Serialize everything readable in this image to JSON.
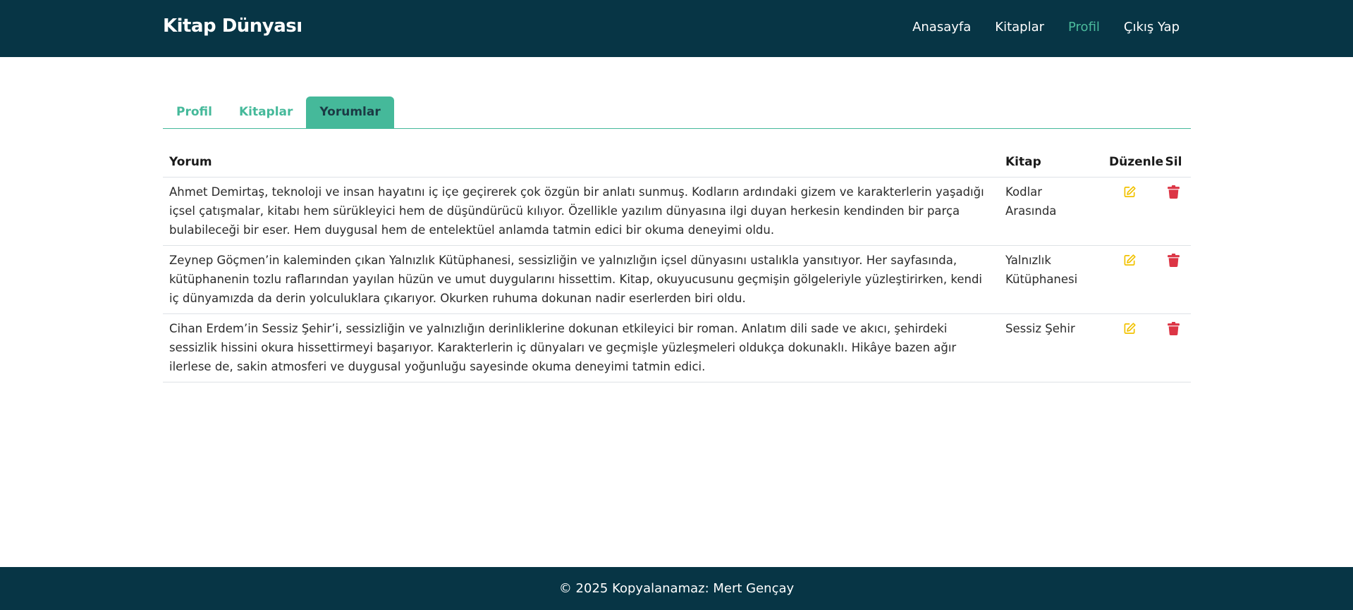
{
  "navbar": {
    "brand": "Kitap Dünyası",
    "links": [
      {
        "label": "Anasayfa"
      },
      {
        "label": "Kitaplar"
      },
      {
        "label": "Profil"
      },
      {
        "label": "Çıkış Yap"
      }
    ],
    "active_link": "Profil",
    "active_color": "#4bbb9c",
    "background": "#073545"
  },
  "tabs": {
    "items": [
      {
        "label": "Profil"
      },
      {
        "label": "Kitaplar"
      },
      {
        "label": "Yorumlar"
      }
    ],
    "active": "Yorumlar",
    "accent": "#45b99a"
  },
  "table": {
    "headers": {
      "comment": "Yorum",
      "book": "Kitap",
      "edit": "Düzenle",
      "delete": "Sil"
    },
    "rows": [
      {
        "comment": "Ahmet Demirtaş, teknoloji ve insan hayatını iç içe geçirerek çok özgün bir anlatı sunmuş. Kodların ardındaki gizem ve karakterlerin yaşadığı içsel çatışmalar, kitabı hem sürükleyici hem de düşündürücü kılıyor. Özellikle yazılım dünyasına ilgi duyan herkesin kendinden bir parça bulabileceği bir eser. Hem duygusal hem de entelektüel anlamda tatmin edici bir okuma deneyimi oldu.",
        "book": "Kodlar Arasında",
        "edit_icon": "edit-icon",
        "delete_icon": "trash-icon"
      },
      {
        "comment": "Zeynep Göçmen’in kaleminden çıkan Yalnızlık Kütüphanesi, sessizliğin ve yalnızlığın içsel dünyasını ustalıkla yansıtıyor. Her sayfasında, kütüphanenin tozlu raflarından yayılan hüzün ve umut duygularını hissettim. Kitap, okuyucusunu geçmişin gölgeleriyle yüzleştirirken, kendi iç dünyamızda da derin yolculuklara çıkarıyor. Okurken ruhuma dokunan nadir eserlerden biri oldu.",
        "book": "Yalnızlık Kütüphanesi",
        "edit_icon": "edit-icon",
        "delete_icon": "trash-icon"
      },
      {
        "comment": "Cihan Erdem’in Sessiz Şehir’i, sessizliğin ve yalnızlığın derinliklerine dokunan etkileyici bir roman. Anlatım dili sade ve akıcı, şehirdeki sessizlik hissini okura hissettirmeyi başarıyor. Karakterlerin iç dünyaları ve geçmişle yüzleşmeleri oldukça dokunaklı. Hikâye bazen ağır ilerlese de, sakin atmosferi ve duygusal yoğunluğu sayesinde okuma deneyimi tatmin edici.",
        "book": "Sessiz Şehir",
        "edit_icon": "edit-icon",
        "delete_icon": "trash-icon"
      }
    ],
    "edit_color": "#f2c200",
    "delete_color": "#dc3545"
  },
  "footer": {
    "text": "© 2025 Kopyalanamaz: Mert Gençay"
  }
}
